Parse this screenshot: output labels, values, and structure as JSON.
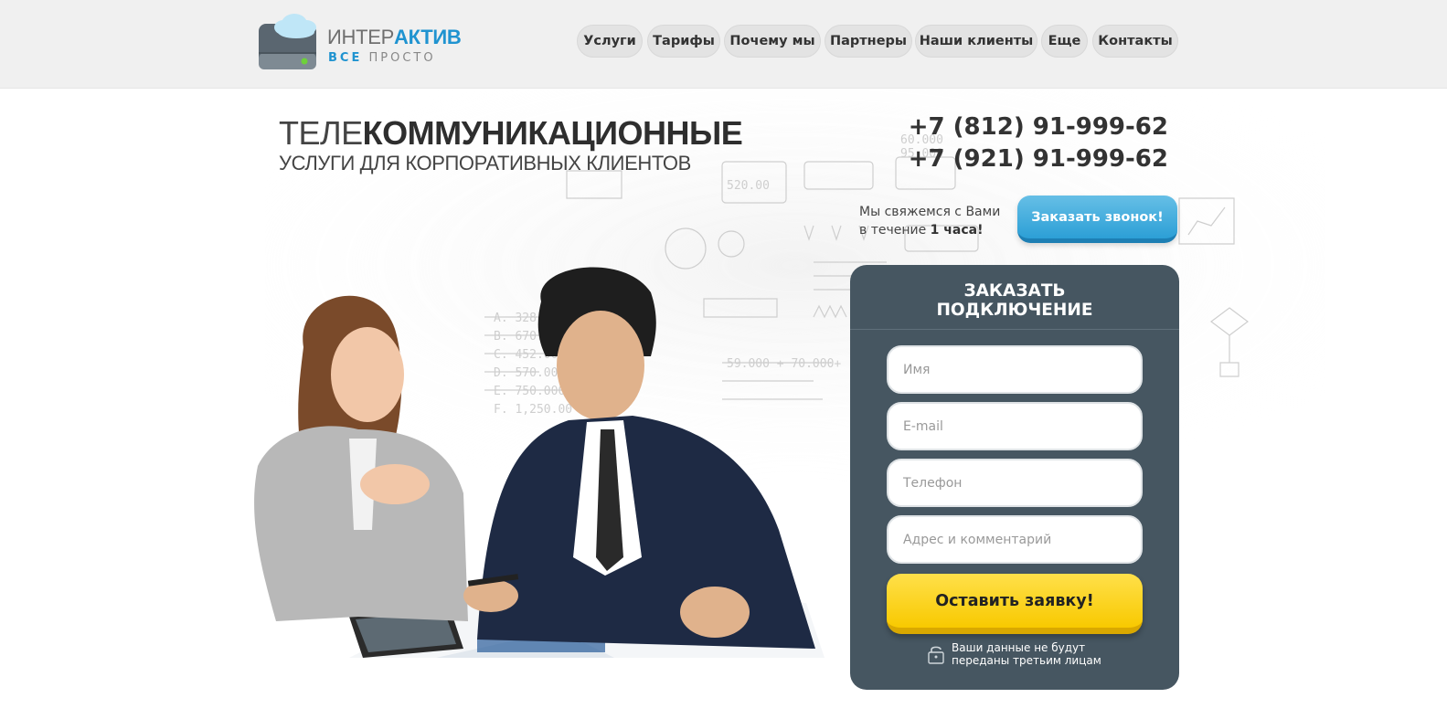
{
  "header": {
    "logo": {
      "title_thin": "ИНТЕР",
      "title_bold": "АКТИВ",
      "tagline_accent": "ВСЕ",
      "tagline_rest": "ПРОСТО"
    },
    "nav": [
      {
        "label": "Услуги"
      },
      {
        "label": "Тарифы"
      },
      {
        "label": "Почему мы"
      },
      {
        "label": "Партнеры"
      },
      {
        "label": "Наши клиенты"
      },
      {
        "label": "Еще"
      },
      {
        "label": "Контакты"
      }
    ]
  },
  "hero": {
    "headline_thin": "ТЕЛЕ",
    "headline_bold": "КОММУНИКАЦИОННЫЕ",
    "subheadline": "УСЛУГИ ДЛЯ КОРПОРАТИВНЫХ КЛИЕНТОВ",
    "phones": [
      "+7 (812) 91-999-62",
      "+7 (921) 91-999-62"
    ],
    "callback_note_line1": "Мы свяжемся с Вами",
    "callback_note_prefix": "в течение ",
    "callback_note_bold": "1 часа!",
    "callback_button": "Заказать звонок!"
  },
  "form": {
    "title_line1": "ЗАКАЗАТЬ",
    "title_line2": "ПОДКЛЮЧЕНИЕ",
    "fields": [
      {
        "placeholder": "Имя"
      },
      {
        "placeholder": "E-mail"
      },
      {
        "placeholder": "Телефон"
      },
      {
        "placeholder": "Адрес и комментарий"
      }
    ],
    "submit": "Оставить заявку!",
    "privacy_line1": "Ваши данные не будут",
    "privacy_line2": "переданы третьим лицам"
  },
  "colors": {
    "accent_blue": "#1f93d0",
    "form_bg": "#465661",
    "submit_yellow": "#f8c900",
    "callback_blue": "#2c9fd6"
  },
  "icons": [
    "cloud-server-logo-icon",
    "lock-icon"
  ]
}
